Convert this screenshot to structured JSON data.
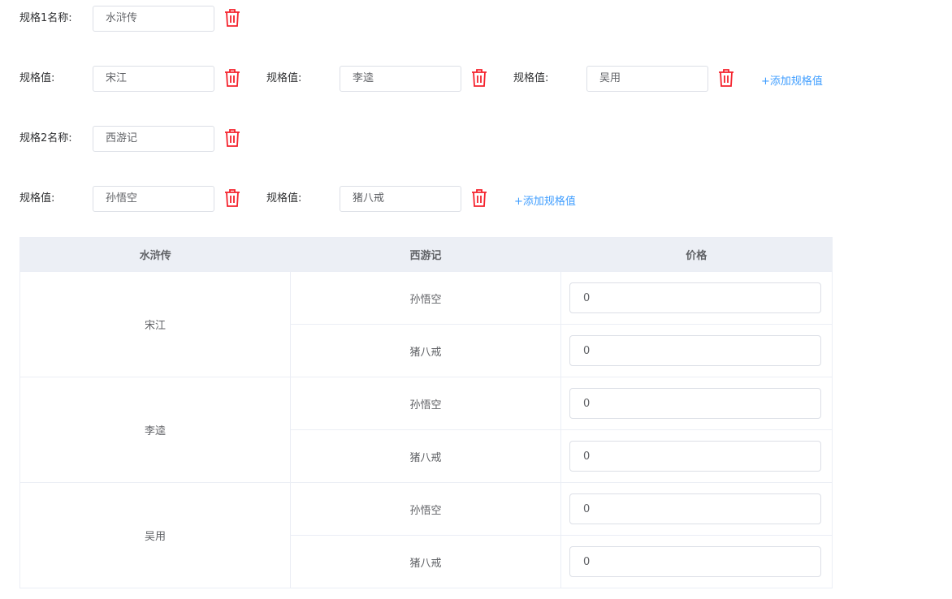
{
  "spec_groups": [
    {
      "name_label": "规格1名称:",
      "name_value": "水浒传",
      "values_label": "规格值:",
      "values": [
        "宋江",
        "李逵",
        "吴用"
      ],
      "add_label": "+添加规格值"
    },
    {
      "name_label": "规格2名称:",
      "name_value": "西游记",
      "values_label": "规格值:",
      "values": [
        "孙悟空",
        "猪八戒"
      ],
      "add_label": "+添加规格值"
    }
  ],
  "table": {
    "headers": [
      "水浒传",
      "西游记",
      "价格"
    ],
    "groups": [
      {
        "name": "宋江",
        "rows": [
          {
            "sub": "孙悟空",
            "price": "0"
          },
          {
            "sub": "猪八戒",
            "price": "0"
          }
        ]
      },
      {
        "name": "李逵",
        "rows": [
          {
            "sub": "孙悟空",
            "price": "0"
          },
          {
            "sub": "猪八戒",
            "price": "0"
          }
        ]
      },
      {
        "name": "吴用",
        "rows": [
          {
            "sub": "孙悟空",
            "price": "0"
          },
          {
            "sub": "猪八戒",
            "price": "0"
          }
        ]
      }
    ]
  },
  "colors": {
    "trash": "#f5222d",
    "link": "#409eff",
    "header_bg": "#eceff5"
  },
  "icons": {
    "delete": "trash-icon"
  }
}
